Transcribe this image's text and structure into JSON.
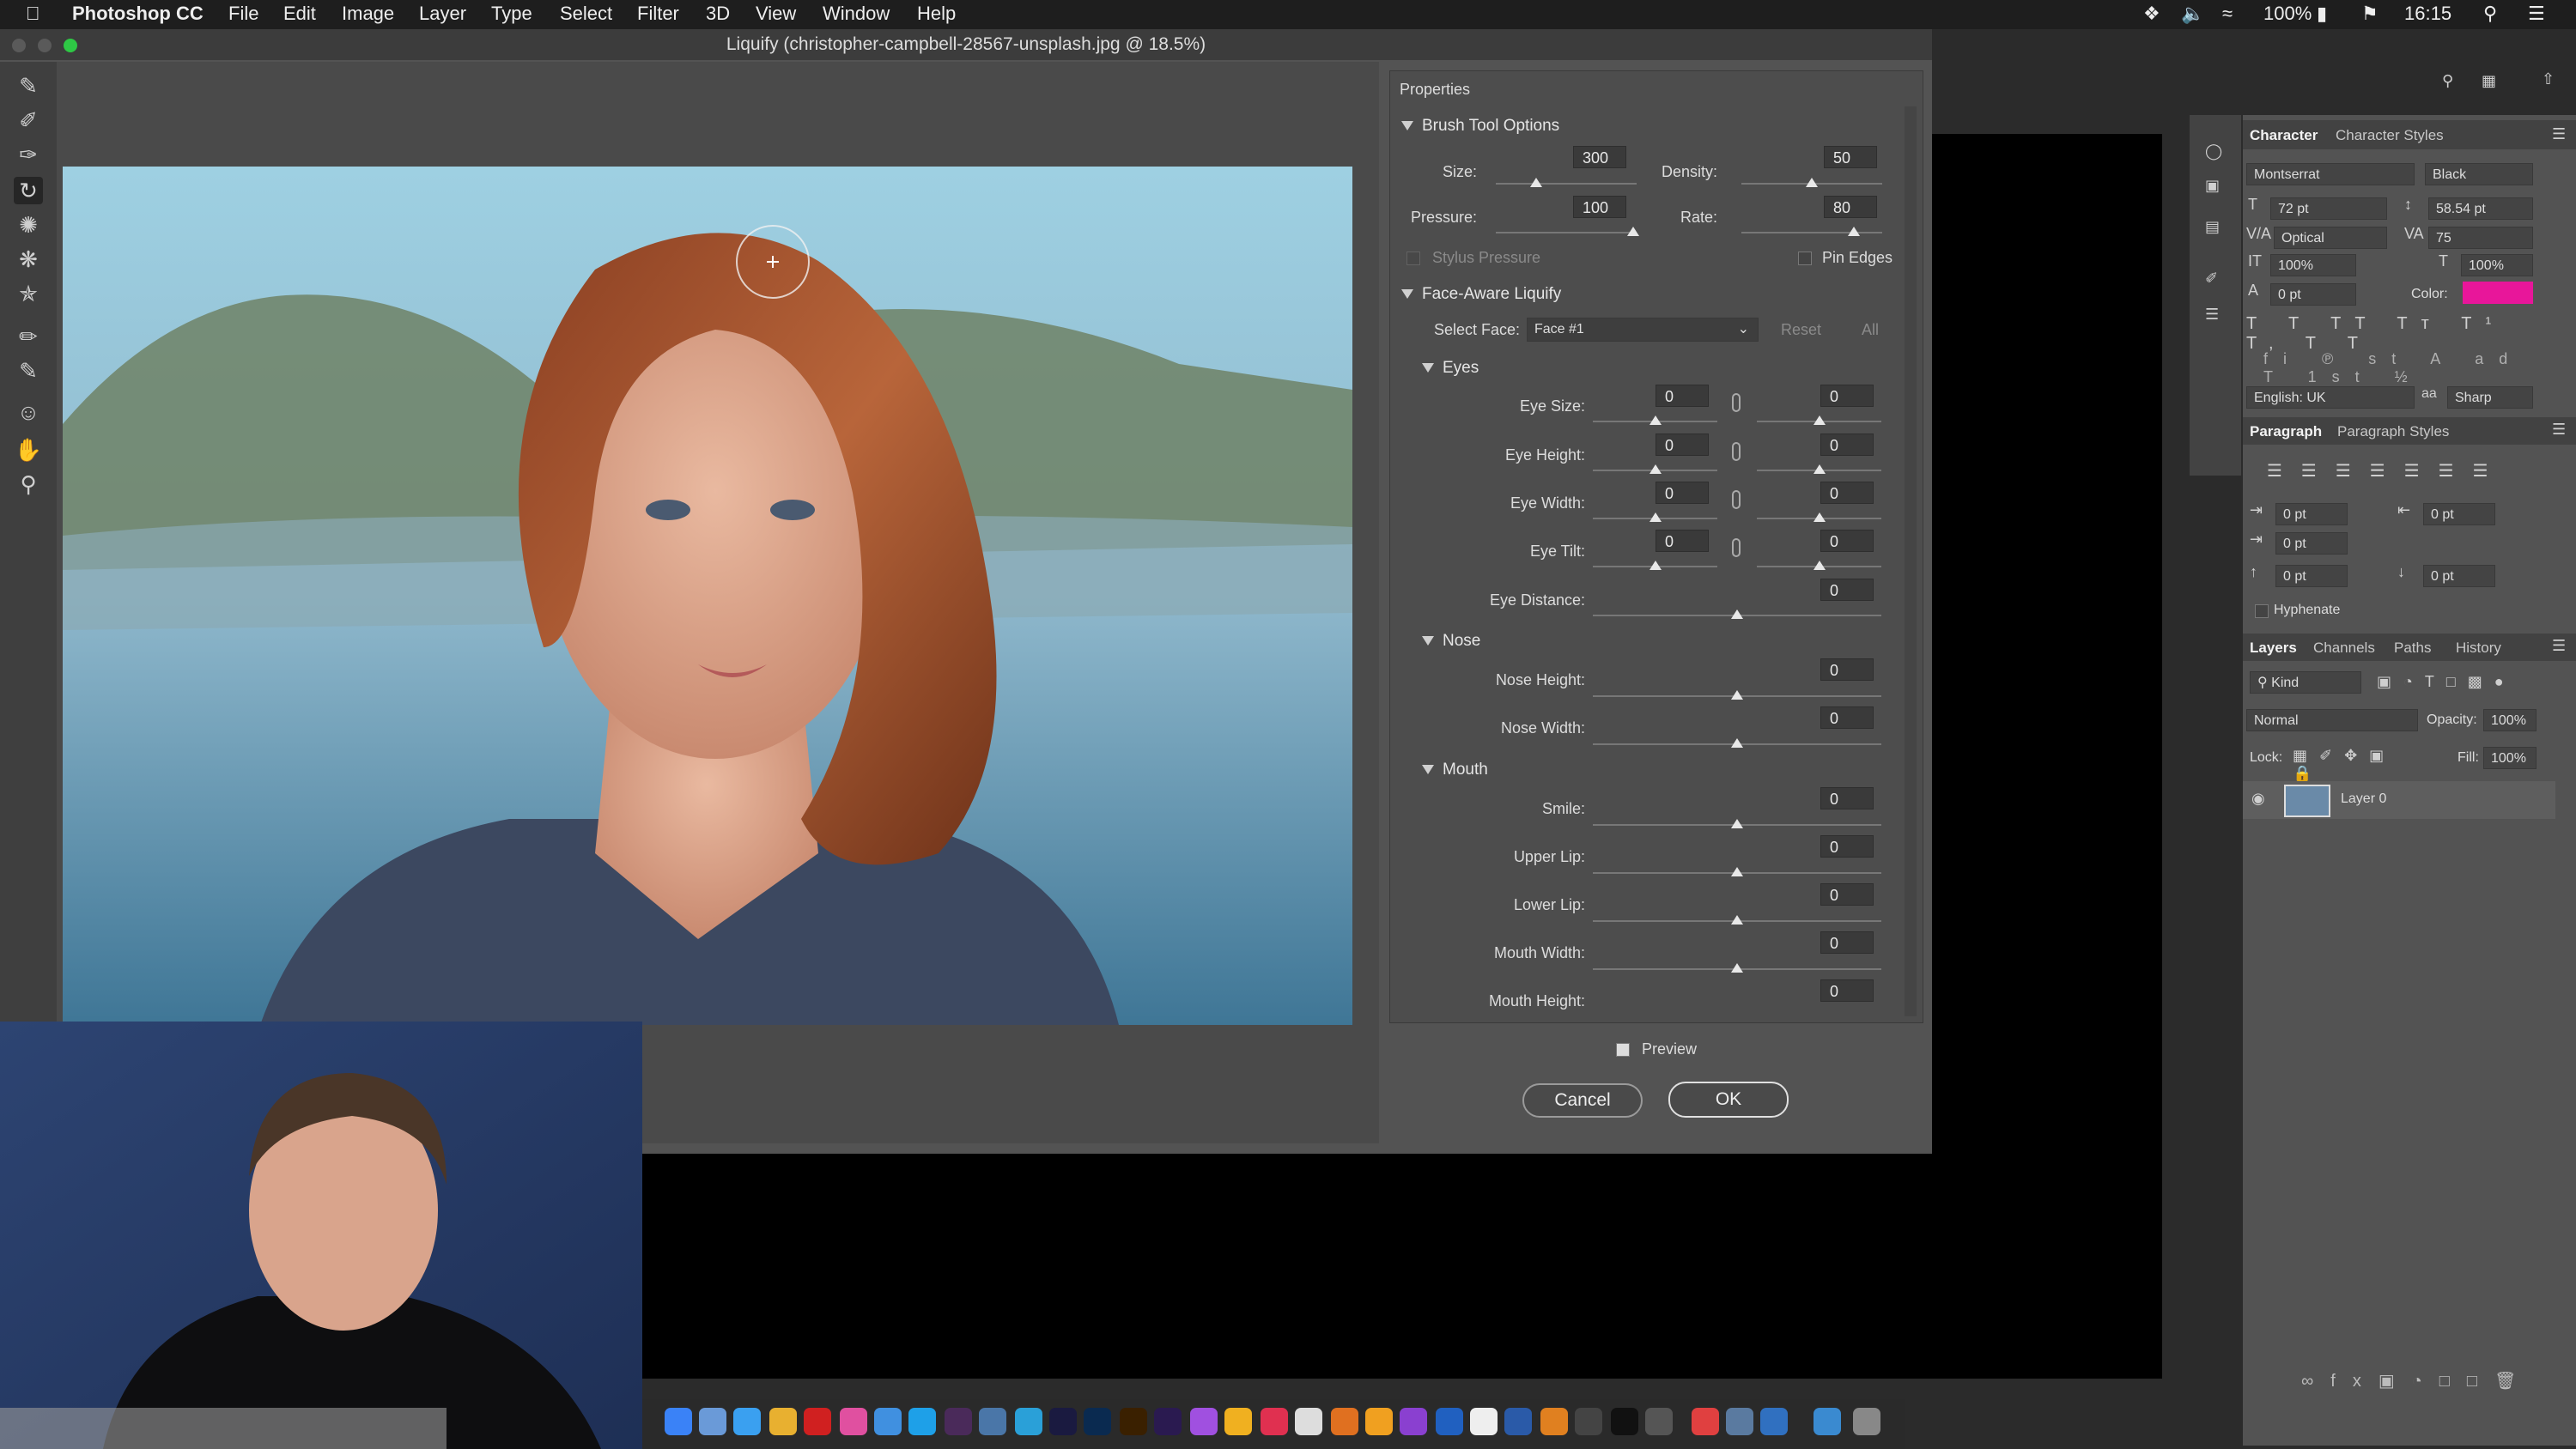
{
  "menubar": {
    "app": "Photoshop CC",
    "items": [
      "File",
      "Edit",
      "Image",
      "Layer",
      "Type",
      "Select",
      "Filter",
      "3D",
      "View",
      "Window",
      "Help"
    ],
    "status": {
      "battery": "100%",
      "time": "16:15"
    }
  },
  "dialog": {
    "title": "Liquify (christopher-campbell-28567-unsplash.jpg @ 18.5%)",
    "properties_title": "Properties",
    "brush": {
      "header": "Brush Tool Options",
      "size_label": "Size:",
      "size": "300",
      "density_label": "Density:",
      "density": "50",
      "pressure_label": "Pressure:",
      "pressure": "100",
      "rate_label": "Rate:",
      "rate": "80",
      "stylus_label": "Stylus Pressure",
      "pin_label": "Pin Edges"
    },
    "face": {
      "header": "Face-Aware Liquify",
      "select_label": "Select Face:",
      "select_value": "Face #1",
      "reset": "Reset",
      "all": "All",
      "eyes": {
        "header": "Eyes",
        "rows": [
          {
            "label": "Eye Size:",
            "left": "0",
            "right": "0"
          },
          {
            "label": "Eye Height:",
            "left": "0",
            "right": "0"
          },
          {
            "label": "Eye Width:",
            "left": "0",
            "right": "0"
          },
          {
            "label": "Eye Tilt:",
            "left": "0",
            "right": "0"
          }
        ],
        "distance_label": "Eye Distance:",
        "distance": "0"
      },
      "nose": {
        "header": "Nose",
        "rows": [
          {
            "label": "Nose Height:",
            "value": "0"
          },
          {
            "label": "Nose Width:",
            "value": "0"
          }
        ]
      },
      "mouth": {
        "header": "Mouth",
        "rows": [
          {
            "label": "Smile:",
            "value": "0"
          },
          {
            "label": "Upper Lip:",
            "value": "0"
          },
          {
            "label": "Lower Lip:",
            "value": "0"
          },
          {
            "label": "Mouth Width:",
            "value": "0"
          },
          {
            "label": "Mouth Height:",
            "value": "0"
          }
        ]
      }
    },
    "preview_label": "Preview",
    "cancel": "Cancel",
    "ok": "OK"
  },
  "character": {
    "tabs": [
      "Character",
      "Character Styles"
    ],
    "font": "Montserrat",
    "style": "Black",
    "size": "72 pt",
    "leading": "58.54 pt",
    "kerning": "Optical",
    "tracking": "75",
    "vscale": "100%",
    "hscale": "100%",
    "baseline": "0 pt",
    "color_label": "Color:",
    "color": "#e8169a",
    "language": "English: UK",
    "aa": "Sharp"
  },
  "paragraph": {
    "tabs": [
      "Paragraph",
      "Paragraph Styles"
    ],
    "indent_left": "0 pt",
    "indent_right": "0 pt",
    "indent_first": "0 pt",
    "space_before": "0 pt",
    "space_after": "0 pt",
    "hyphenate": "Hyphenate"
  },
  "layers": {
    "tabs": [
      "Layers",
      "Channels",
      "Paths",
      "History"
    ],
    "kind": "Kind",
    "blend": "Normal",
    "opacity_label": "Opacity:",
    "opacity": "100%",
    "lock_label": "Lock:",
    "fill_label": "Fill:",
    "fill": "100%",
    "layer_name": "Layer 0"
  }
}
